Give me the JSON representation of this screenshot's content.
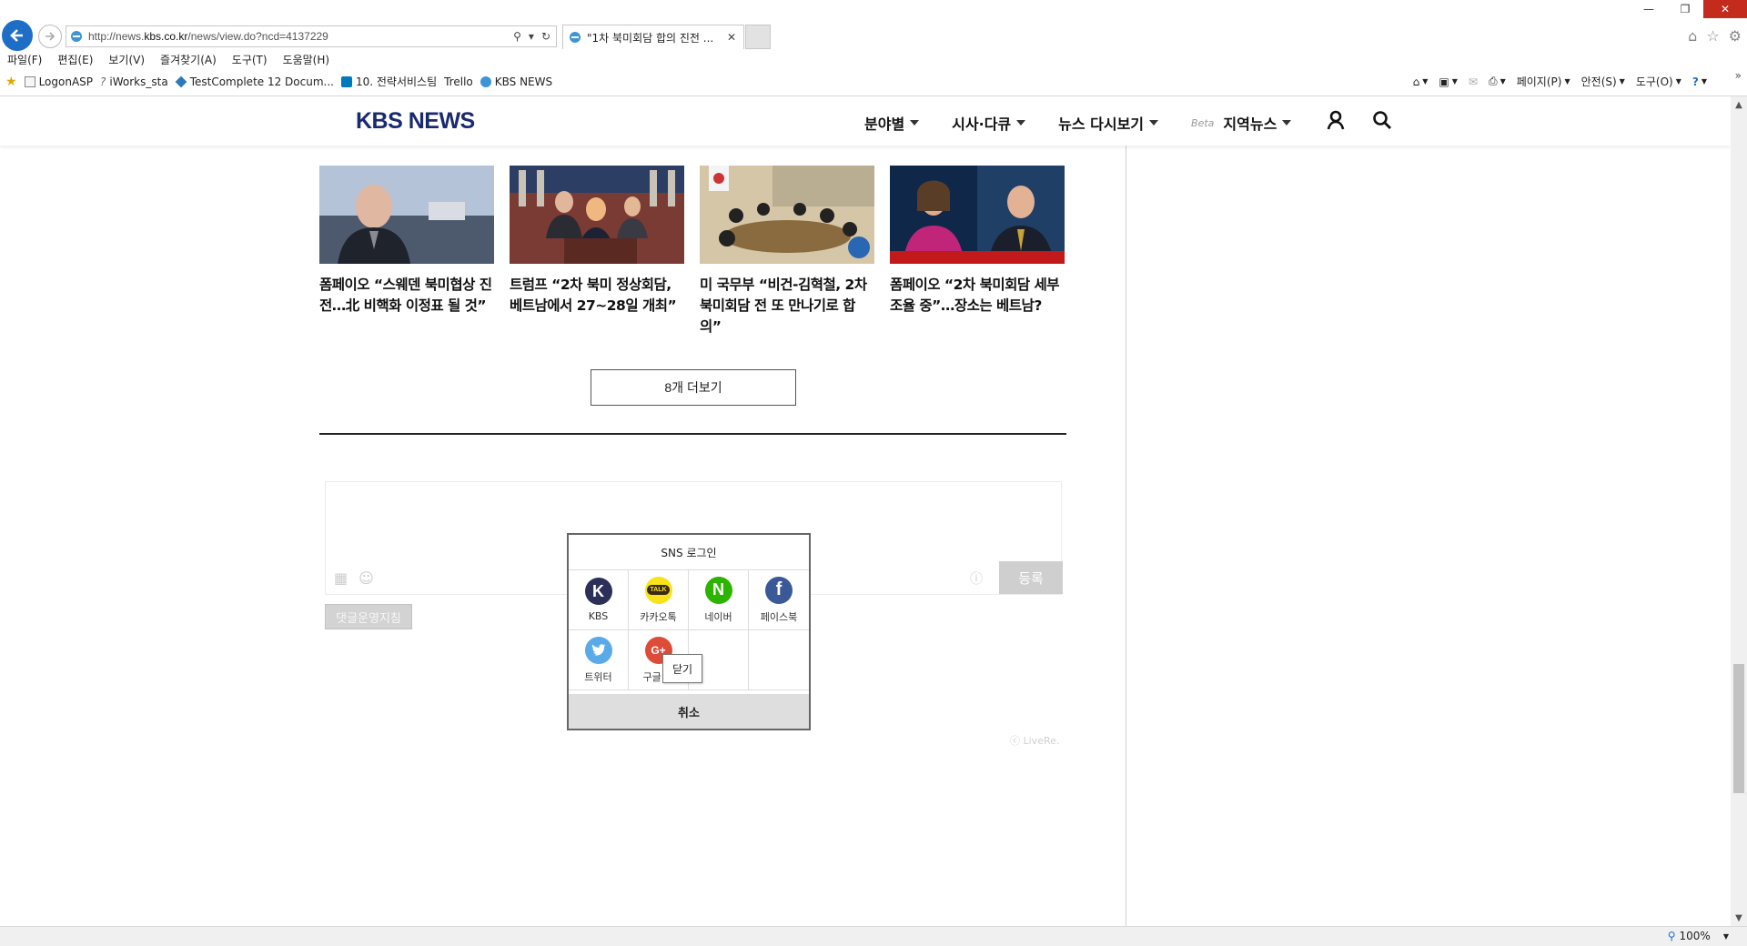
{
  "browser": {
    "url_prefix": "http://news.",
    "url_domain": "kbs.co.kr",
    "url_path": "/news/view.do?ncd=4137229",
    "tab_title": "\"1차 북미회담 합의 진전 ...",
    "menu": [
      "파일(F)",
      "편집(E)",
      "보기(V)",
      "즐겨찾기(A)",
      "도구(T)",
      "도움말(H)"
    ],
    "favorites": [
      "LogonASP",
      "iWorks_sta",
      "TestComplete 12 Docum...",
      "10. 전략서비스팀",
      "Trello",
      "KBS NEWS"
    ],
    "commands": [
      "페이지(P)",
      "안전(S)",
      "도구(O)"
    ],
    "zoom": "100%"
  },
  "site": {
    "logo": "KBS NEWS",
    "nav": [
      "분야별",
      "시사·다큐",
      "뉴스 다시보기"
    ],
    "nav_beta": "Beta",
    "nav_regional": "지역뉴스"
  },
  "news": [
    {
      "headline": "폼페이오 “스웨덴 북미협상 진전…北 비핵화 이정표 될 것”"
    },
    {
      "headline": "트럼프 “2차 북미 정상회담, 베트남에서 27~28일 개최”"
    },
    {
      "headline": "미 국무부 “비건-김혁철, 2차 북미회담 전 또 만나기로 합의”"
    },
    {
      "headline": "폼페이오 “2차 북미회담 세부 조율 중”…장소는 베트남?"
    }
  ],
  "more_button": "8개 더보기",
  "comment": {
    "submit": "등록",
    "policy": "댓글운영지침",
    "livere": "ⓒ LiveRe."
  },
  "sns": {
    "title": "SNS 로그인",
    "providers": [
      {
        "label": "KBS",
        "glyph": "K",
        "color": "#2b2f5a"
      },
      {
        "label": "카카오톡",
        "glyph": "TALK",
        "color": "#f7e317"
      },
      {
        "label": "네이버",
        "glyph": "N",
        "color": "#2db400"
      },
      {
        "label": "페이스북",
        "glyph": "f",
        "color": "#3b5998"
      },
      {
        "label": "트위터",
        "glyph": "t",
        "color": "#5aaaea"
      },
      {
        "label": "구글 플",
        "glyph": "G+",
        "color": "#dd4b39"
      }
    ],
    "cancel": "취소",
    "tooltip": "닫기"
  }
}
